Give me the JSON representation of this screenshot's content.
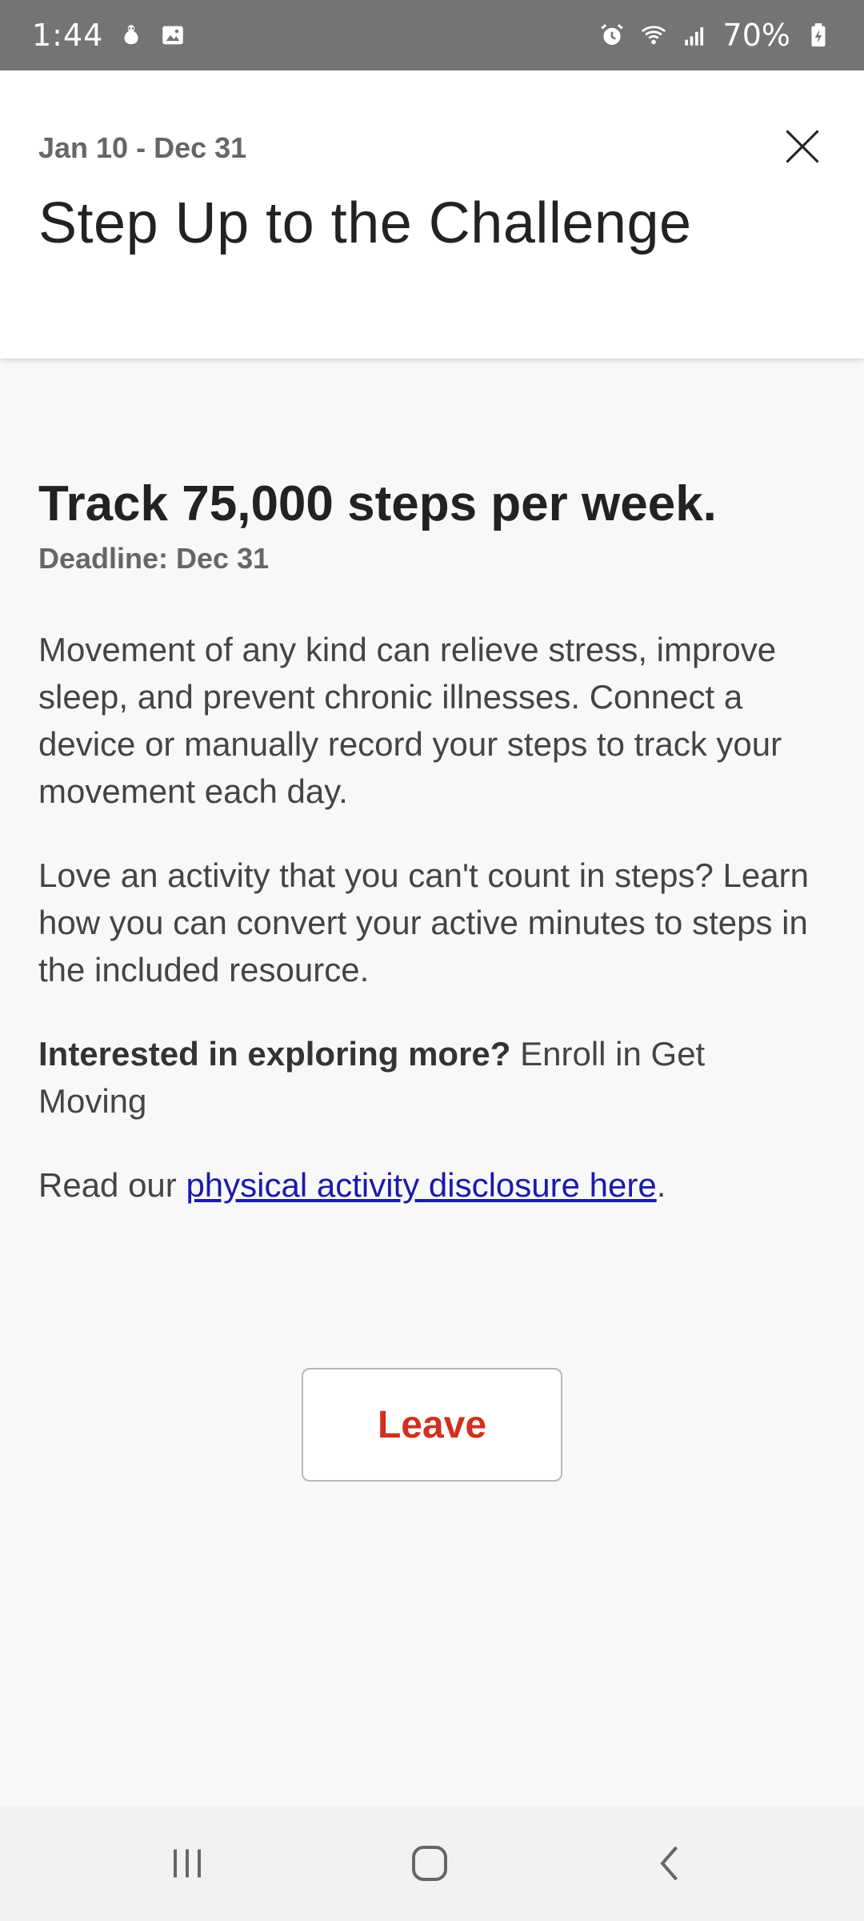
{
  "status_bar": {
    "time": "1:44",
    "battery": "70%",
    "icons": [
      "notification-icon",
      "gallery-icon",
      "alarm-icon",
      "wifi-icon",
      "signal-icon",
      "battery-icon"
    ]
  },
  "header": {
    "date_range": "Jan 10 - Dec 31",
    "title": "Step Up to the Challenge",
    "close_icon": "close-icon"
  },
  "content": {
    "goal_title": "Track 75,000 steps per week.",
    "deadline": "Deadline: Dec 31",
    "paragraph_1": "Movement of any kind can relieve stress, improve sleep, and prevent chronic illnesses. Connect a device or manually record your steps to track your movement each day.",
    "paragraph_2": "Love an activity that you can't count in steps? Learn how you can convert your active minutes to steps in the included resource.",
    "explore_bold": "Interested in exploring more?",
    "explore_text": " Enroll in Get Moving",
    "disclosure_prefix": "Read our ",
    "disclosure_link": "physical activity disclosure here",
    "disclosure_suffix": "."
  },
  "actions": {
    "leave_label": "Leave"
  },
  "nav_bar": {
    "icons": [
      "recents-icon",
      "home-icon",
      "back-icon"
    ]
  },
  "colors": {
    "status_bar_bg": "#747474",
    "background": "#f8f8f8",
    "leave_text": "#d32f1f",
    "link": "#1a1aaa",
    "muted_text": "#666666"
  }
}
